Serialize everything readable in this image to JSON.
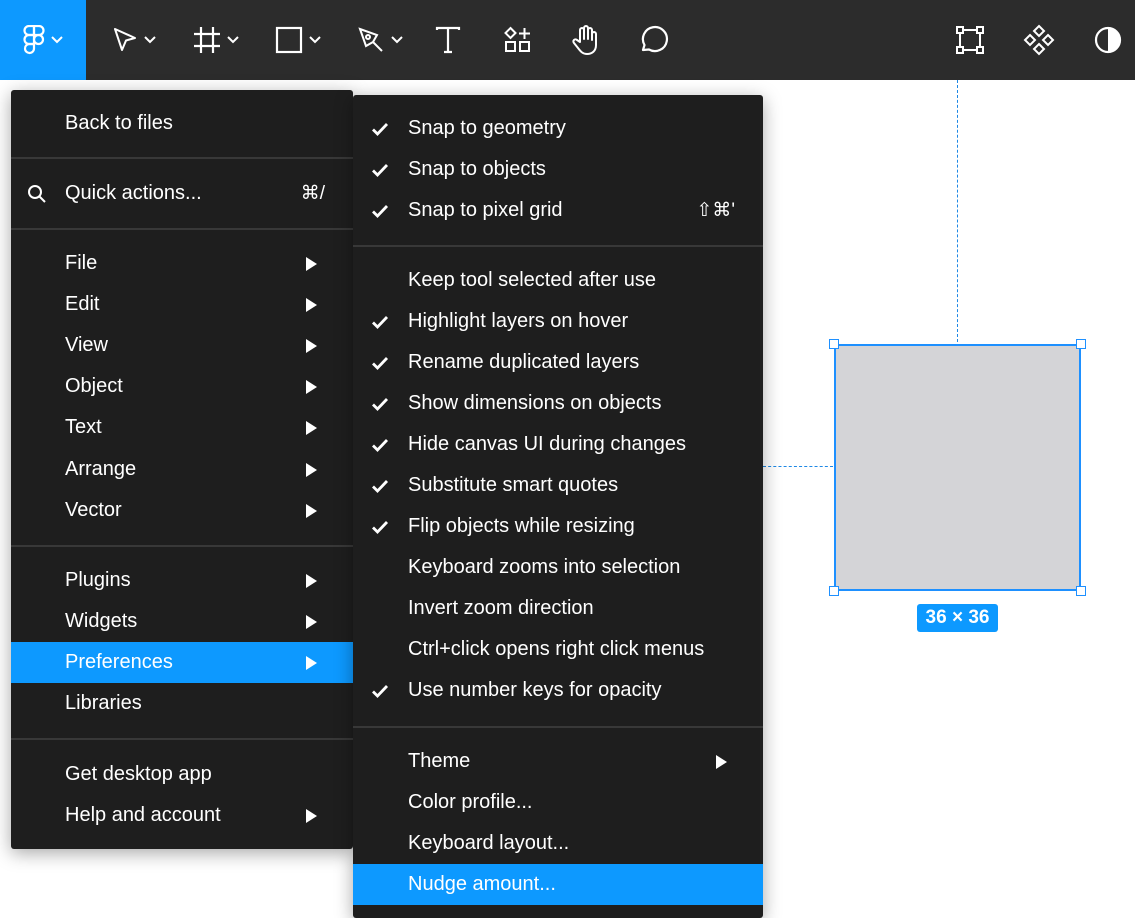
{
  "colors": {
    "accent": "#0d99ff",
    "toolbar": "#2c2c2c",
    "menu": "#1e1e1e"
  },
  "toolbar": {
    "tools": [
      "figma-logo-icon",
      "move-tool-icon",
      "frame-tool-icon",
      "rectangle-tool-icon",
      "pen-tool-icon",
      "text-tool-icon",
      "resources-icon",
      "hand-tool-icon",
      "comment-tool-icon",
      "edit-object-icon",
      "component-icon",
      "contrast-icon"
    ]
  },
  "main_menu": {
    "back": "Back to files",
    "quick_actions": {
      "label": "Quick actions...",
      "shortcut": "⌘/"
    },
    "items": [
      {
        "label": "File"
      },
      {
        "label": "Edit"
      },
      {
        "label": "View"
      },
      {
        "label": "Object"
      },
      {
        "label": "Text"
      },
      {
        "label": "Arrange"
      },
      {
        "label": "Vector"
      },
      {
        "label": "Plugins"
      },
      {
        "label": "Widgets"
      },
      {
        "label": "Preferences"
      },
      {
        "label": "Libraries"
      },
      {
        "label": "Get desktop app"
      },
      {
        "label": "Help and account"
      }
    ]
  },
  "sub_menu": {
    "items": [
      {
        "label": "Snap to geometry",
        "checked": true
      },
      {
        "label": "Snap to objects",
        "checked": true
      },
      {
        "label": "Snap to pixel grid",
        "checked": true,
        "shortcut": "⇧⌘'"
      },
      {
        "label": "Keep tool selected after use",
        "checked": false
      },
      {
        "label": "Highlight layers on hover",
        "checked": true
      },
      {
        "label": "Rename duplicated layers",
        "checked": true
      },
      {
        "label": "Show dimensions on objects",
        "checked": true
      },
      {
        "label": "Hide canvas UI during changes",
        "checked": true
      },
      {
        "label": "Substitute smart quotes",
        "checked": true
      },
      {
        "label": "Flip objects while resizing",
        "checked": true
      },
      {
        "label": "Keyboard zooms into selection",
        "checked": false
      },
      {
        "label": "Invert zoom direction",
        "checked": false
      },
      {
        "label": "Ctrl+click opens right click menus",
        "checked": false
      },
      {
        "label": "Use number keys for opacity",
        "checked": true
      },
      {
        "label": "Theme"
      },
      {
        "label": "Color profile..."
      },
      {
        "label": "Keyboard layout..."
      },
      {
        "label": "Nudge amount..."
      }
    ]
  },
  "canvas": {
    "dimension_label": "36 × 36"
  }
}
